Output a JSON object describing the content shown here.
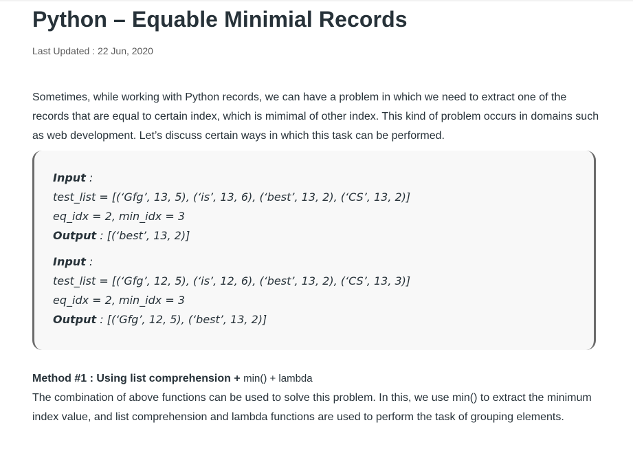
{
  "article": {
    "title": "Python – Equable Minimial Records",
    "last_updated": "Last Updated : 22 Jun, 2020",
    "intro": "Sometimes, while working with Python records, we can have a problem in which we need to extract one of the records that are equal to certain index, which is mimimal of other index. This kind of problem occurs in domains such as web development. Let’s discuss certain ways in which this task can be performed."
  },
  "examples": [
    {
      "input_label": "Input",
      "input_sep": " :",
      "test_list": "test_list = [(‘Gfg’, 13, 5), (‘is’, 13, 6), (‘best’, 13, 2), (‘CS’, 13, 2)]",
      "params": "eq_idx = 2, min_idx = 3",
      "output_label": "Output",
      "output_value": " : [(‘best’, 13, 2)]"
    },
    {
      "input_label": "Input",
      "input_sep": " :",
      "test_list": "test_list = [(‘Gfg’, 12, 5), (‘is’, 12, 6), (‘best’, 13, 2), (‘CS’, 13, 3)]",
      "params": "eq_idx = 2, min_idx = 3",
      "output_label": "Output",
      "output_value": " : [(‘Gfg’, 12, 5), (‘best’, 13, 2)]"
    }
  ],
  "method": {
    "heading": "Method #1 : Using list comprehension + ",
    "heading_code": "min() + lambda",
    "description": "The combination of above functions can be used to solve this problem. In this, we use min() to extract the minimum index value, and list comprehension and lambda functions are used to perform the task of grouping elements."
  }
}
